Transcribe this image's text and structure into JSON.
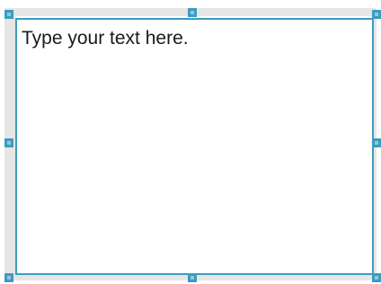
{
  "text_box": {
    "content": "Type your text here."
  },
  "colors": {
    "selection_border": "#3c9cc1",
    "handle_fill": "#3c9cc1",
    "handle_inner": "#8fc8dd",
    "canvas_strip": "#e6e6e6",
    "text": "#1a1a1a",
    "background": "#ffffff"
  },
  "handles": [
    "top-left",
    "top-center",
    "top-right",
    "middle-left",
    "middle-right",
    "bottom-left",
    "bottom-center",
    "bottom-right"
  ]
}
